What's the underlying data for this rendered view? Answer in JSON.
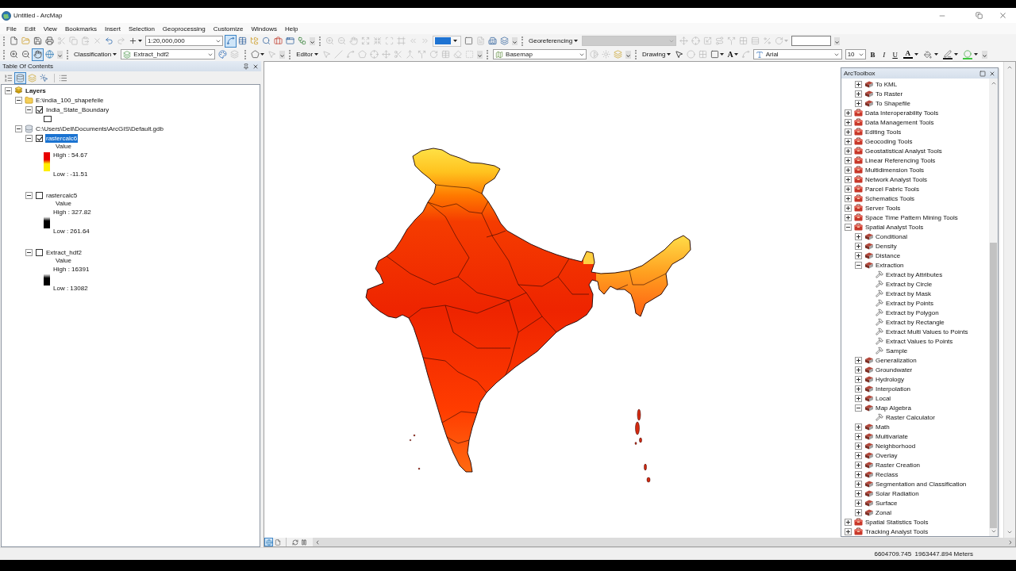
{
  "window": {
    "title": "Untitled - ArcMap"
  },
  "menu": [
    "File",
    "Edit",
    "View",
    "Bookmarks",
    "Insert",
    "Selection",
    "Geoprocessing",
    "Customize",
    "Windows",
    "Help"
  ],
  "toolbar_rows": [
    [
      [
        {
          "kind": "button",
          "disabled": false
        },
        {
          "kind": "button",
          "disabled": false
        },
        {
          "kind": "button",
          "disabled": false
        },
        {
          "kind": "button",
          "disabled": false
        },
        {
          "kind": "button",
          "disabled": true
        },
        {
          "kind": "button",
          "disabled": true
        },
        {
          "kind": "button",
          "disabled": true
        },
        {
          "kind": "button",
          "disabled": true
        },
        {
          "kind": "button",
          "disabled": false
        },
        {
          "kind": "button",
          "disabled": true
        },
        {
          "kind": "split",
          "disabled": false
        },
        {
          "kind": "combo",
          "value": "1:20,000,000",
          "disabled": false
        },
        {
          "kind": "tool",
          "selected": true
        },
        {
          "kind": "button",
          "disabled": false
        },
        {
          "kind": "button",
          "disabled": false
        },
        {
          "kind": "button",
          "disabled": false
        },
        {
          "kind": "button",
          "disabled": false
        },
        {
          "kind": "button",
          "disabled": false
        },
        {
          "kind": "button",
          "disabled": false
        },
        {
          "kind": "options"
        }
      ],
      [
        {
          "kind": "button",
          "disabled": true
        },
        {
          "kind": "button",
          "disabled": true
        },
        {
          "kind": "button",
          "disabled": true
        },
        {
          "kind": "button",
          "disabled": true
        },
        {
          "kind": "button",
          "disabled": true
        },
        {
          "kind": "button",
          "disabled": true
        },
        {
          "kind": "button",
          "disabled": true
        },
        {
          "kind": "button",
          "disabled": true
        },
        {
          "kind": "button",
          "disabled": true
        },
        {
          "kind": "swatch",
          "color": "#1e73d2"
        },
        {
          "kind": "button",
          "disabled": false
        },
        {
          "kind": "button",
          "disabled": true
        },
        {
          "kind": "button",
          "disabled": false
        },
        {
          "kind": "button",
          "disabled": false
        },
        {
          "kind": "options"
        }
      ],
      [
        {
          "kind": "dropdown",
          "label": "Georeferencing"
        },
        {
          "kind": "combo",
          "disabled": true
        },
        {
          "kind": "button",
          "disabled": true
        },
        {
          "kind": "button",
          "disabled": true
        },
        {
          "kind": "button",
          "disabled": true
        },
        {
          "kind": "button",
          "disabled": true
        },
        {
          "kind": "button",
          "disabled": true
        },
        {
          "kind": "button",
          "disabled": true
        },
        {
          "kind": "button",
          "disabled": true
        },
        {
          "kind": "button",
          "disabled": true
        },
        {
          "kind": "split",
          "disabled": true
        },
        {
          "kind": "field"
        },
        {
          "kind": "options"
        }
      ]
    ],
    [
      [
        {
          "kind": "tool",
          "selected": false
        },
        {
          "kind": "tool",
          "selected": false
        },
        {
          "kind": "tool",
          "selected": true
        },
        {
          "kind": "button",
          "disabled": false
        },
        {
          "kind": "options"
        }
      ],
      [
        {
          "kind": "dropdown",
          "label": "Classification"
        },
        {
          "kind": "icon-combo",
          "value": "Extract_hdf2"
        },
        {
          "kind": "button",
          "disabled": false
        },
        {
          "kind": "button",
          "disabled": true
        }
      ],
      [
        {
          "kind": "split",
          "disabled": false
        },
        {
          "kind": "button",
          "disabled": true
        },
        {
          "kind": "options"
        }
      ],
      [
        {
          "kind": "dropdown",
          "label": "Editor"
        },
        {
          "kind": "button",
          "disabled": true
        },
        {
          "kind": "button",
          "disabled": true
        },
        {
          "kind": "button",
          "disabled": true
        },
        {
          "kind": "button",
          "disabled": true
        },
        {
          "kind": "button",
          "disabled": true
        },
        {
          "kind": "button",
          "disabled": true
        },
        {
          "kind": "button",
          "disabled": true
        },
        {
          "kind": "button",
          "disabled": true
        },
        {
          "kind": "button",
          "disabled": true
        },
        {
          "kind": "button",
          "disabled": true
        },
        {
          "kind": "button",
          "disabled": true
        },
        {
          "kind": "button",
          "disabled": true
        },
        {
          "kind": "button",
          "disabled": true
        },
        {
          "kind": "options"
        }
      ],
      [
        {
          "kind": "icon-combo",
          "value": "Basemap"
        },
        {
          "kind": "button",
          "disabled": true
        },
        {
          "kind": "button",
          "disabled": true
        },
        {
          "kind": "button",
          "disabled": false
        },
        {
          "kind": "options"
        }
      ],
      [
        {
          "kind": "dropdown",
          "label": "Drawing"
        },
        {
          "kind": "tool",
          "selected": false
        },
        {
          "kind": "button",
          "disabled": true
        },
        {
          "kind": "button",
          "disabled": true
        },
        {
          "kind": "split",
          "disabled": false
        },
        {
          "kind": "text-split",
          "label": "A"
        },
        {
          "kind": "button",
          "disabled": true
        },
        {
          "kind": "icon-combo",
          "value": "Arial"
        },
        {
          "kind": "combo",
          "value": "10",
          "disabled": false
        },
        {
          "kind": "text-button",
          "label": "B"
        },
        {
          "kind": "text-button",
          "label": "I"
        },
        {
          "kind": "text-button",
          "label": "U"
        },
        {
          "kind": "color",
          "label": "A",
          "color": "#000000"
        },
        {
          "kind": "color"
        },
        {
          "kind": "color",
          "color": "#1a1a1a"
        },
        {
          "kind": "color",
          "color": "#3cc83c"
        },
        {
          "kind": "options"
        }
      ]
    ]
  ],
  "toc": {
    "title": "Table Of Contents",
    "view_buttons": [
      {
        "selected": false
      },
      {
        "selected": true
      },
      {
        "selected": false
      },
      {
        "selected": false
      }
    ],
    "tree": {
      "label": "Layers",
      "expanded": true,
      "children": [
        {
          "kind": "folder",
          "label": "E:\\india_100_shapefeile",
          "expanded": true,
          "children": [
            {
              "label": "India_State_Boundary",
              "checked": true,
              "selected": false,
              "expanded": true,
              "legend": {
                "kind": "polygon"
              }
            }
          ]
        },
        {
          "kind": "database",
          "label": "C:\\Users\\Dell\\Documents\\ArcGIS\\Default.gdb",
          "expanded": true,
          "children": [
            {
              "label": "rastercalc6",
              "checked": true,
              "selected": true,
              "expanded": true,
              "legend": {
                "kind": "ramp",
                "heading": "Value",
                "high": "High : 54.67",
                "low": "Low : -11.51",
                "ramp": [
                  {
                    "color": "#e80000"
                  },
                  {
                    "color": "#ffee00"
                  }
                ]
              }
            },
            {
              "label": "rastercalc5",
              "checked": false,
              "selected": false,
              "expanded": true,
              "legend": {
                "kind": "ramp",
                "heading": "Value",
                "high": "High : 327.82",
                "low": "Low : 261.64",
                "ramp": [
                  {
                    "color": "#ffffff"
                  },
                  {
                    "color": "#000000"
                  }
                ]
              }
            },
            {
              "label": "Extract_hdf2",
              "checked": false,
              "selected": false,
              "expanded": true,
              "legend": {
                "kind": "ramp",
                "heading": "Value",
                "high": "High : 16391",
                "low": "Low : 13082",
                "ramp": [
                  {
                    "color": "#ffffff"
                  },
                  {
                    "color": "#000000"
                  }
                ]
              }
            }
          ]
        }
      ]
    }
  },
  "map_view": {
    "view_buttons": [
      {
        "selected": true
      },
      {
        "selected": false
      }
    ]
  },
  "toolbox": {
    "title": "ArcToolbox",
    "continued": [
      {
        "kind": "toolset",
        "label": "To KML",
        "expanded": false
      },
      {
        "kind": "toolset",
        "label": "To Raster",
        "expanded": false
      },
      {
        "kind": "toolset",
        "label": "To Shapefile",
        "expanded": false
      }
    ],
    "items": [
      {
        "kind": "toolbox",
        "label": "Data Interoperability Tools",
        "expanded": false
      },
      {
        "kind": "toolbox",
        "label": "Data Management Tools",
        "expanded": false
      },
      {
        "kind": "toolbox",
        "label": "Editing Tools",
        "expanded": false
      },
      {
        "kind": "toolbox",
        "label": "Geocoding Tools",
        "expanded": false
      },
      {
        "kind": "toolbox",
        "label": "Geostatistical Analyst Tools",
        "expanded": false
      },
      {
        "kind": "toolbox",
        "label": "Linear Referencing Tools",
        "expanded": false
      },
      {
        "kind": "toolbox",
        "label": "Multidimension Tools",
        "expanded": false
      },
      {
        "kind": "toolbox",
        "label": "Network Analyst Tools",
        "expanded": false
      },
      {
        "kind": "toolbox",
        "label": "Parcel Fabric Tools",
        "expanded": false
      },
      {
        "kind": "toolbox",
        "label": "Schematics Tools",
        "expanded": false
      },
      {
        "kind": "toolbox",
        "label": "Server Tools",
        "expanded": false
      },
      {
        "kind": "toolbox",
        "label": "Space Time Pattern Mining Tools",
        "expanded": false
      },
      {
        "kind": "toolbox",
        "label": "Spatial Analyst Tools",
        "expanded": true,
        "children": [
          {
            "kind": "toolset",
            "label": "Conditional",
            "expanded": false
          },
          {
            "kind": "toolset",
            "label": "Density",
            "expanded": false
          },
          {
            "kind": "toolset",
            "label": "Distance",
            "expanded": false
          },
          {
            "kind": "toolset",
            "label": "Extraction",
            "expanded": true,
            "children": [
              {
                "kind": "tool",
                "label": "Extract by Attributes"
              },
              {
                "kind": "tool",
                "label": "Extract by Circle"
              },
              {
                "kind": "tool",
                "label": "Extract by Mask"
              },
              {
                "kind": "tool",
                "label": "Extract by Points"
              },
              {
                "kind": "tool",
                "label": "Extract by Polygon"
              },
              {
                "kind": "tool",
                "label": "Extract by Rectangle"
              },
              {
                "kind": "tool",
                "label": "Extract Multi Values to Points"
              },
              {
                "kind": "tool",
                "label": "Extract Values to Points"
              },
              {
                "kind": "tool",
                "label": "Sample"
              }
            ]
          },
          {
            "kind": "toolset",
            "label": "Generalization",
            "expanded": false
          },
          {
            "kind": "toolset",
            "label": "Groundwater",
            "expanded": false
          },
          {
            "kind": "toolset",
            "label": "Hydrology",
            "expanded": false
          },
          {
            "kind": "toolset",
            "label": "Interpolation",
            "expanded": false
          },
          {
            "kind": "toolset",
            "label": "Local",
            "expanded": false
          },
          {
            "kind": "toolset",
            "label": "Map Algebra",
            "expanded": true,
            "children": [
              {
                "kind": "tool",
                "label": "Raster Calculator"
              }
            ]
          },
          {
            "kind": "toolset",
            "label": "Math",
            "expanded": false
          },
          {
            "kind": "toolset",
            "label": "Multivariate",
            "expanded": false
          },
          {
            "kind": "toolset",
            "label": "Neighborhood",
            "expanded": false
          },
          {
            "kind": "toolset",
            "label": "Overlay",
            "expanded": false
          },
          {
            "kind": "toolset",
            "label": "Raster Creation",
            "expanded": false
          },
          {
            "kind": "toolset",
            "label": "Reclass",
            "expanded": false
          },
          {
            "kind": "toolset",
            "label": "Segmentation and Classification",
            "expanded": false
          },
          {
            "kind": "toolset",
            "label": "Solar Radiation",
            "expanded": false
          },
          {
            "kind": "toolset",
            "label": "Surface",
            "expanded": false
          },
          {
            "kind": "toolset",
            "label": "Zonal",
            "expanded": false
          }
        ]
      },
      {
        "kind": "toolbox",
        "label": "Spatial Statistics Tools",
        "expanded": false
      },
      {
        "kind": "toolbox",
        "label": "Tracking Analyst Tools",
        "expanded": false
      }
    ]
  },
  "status_bar": {
    "coordinates": "6604709.745  1963447.894 Meters"
  }
}
